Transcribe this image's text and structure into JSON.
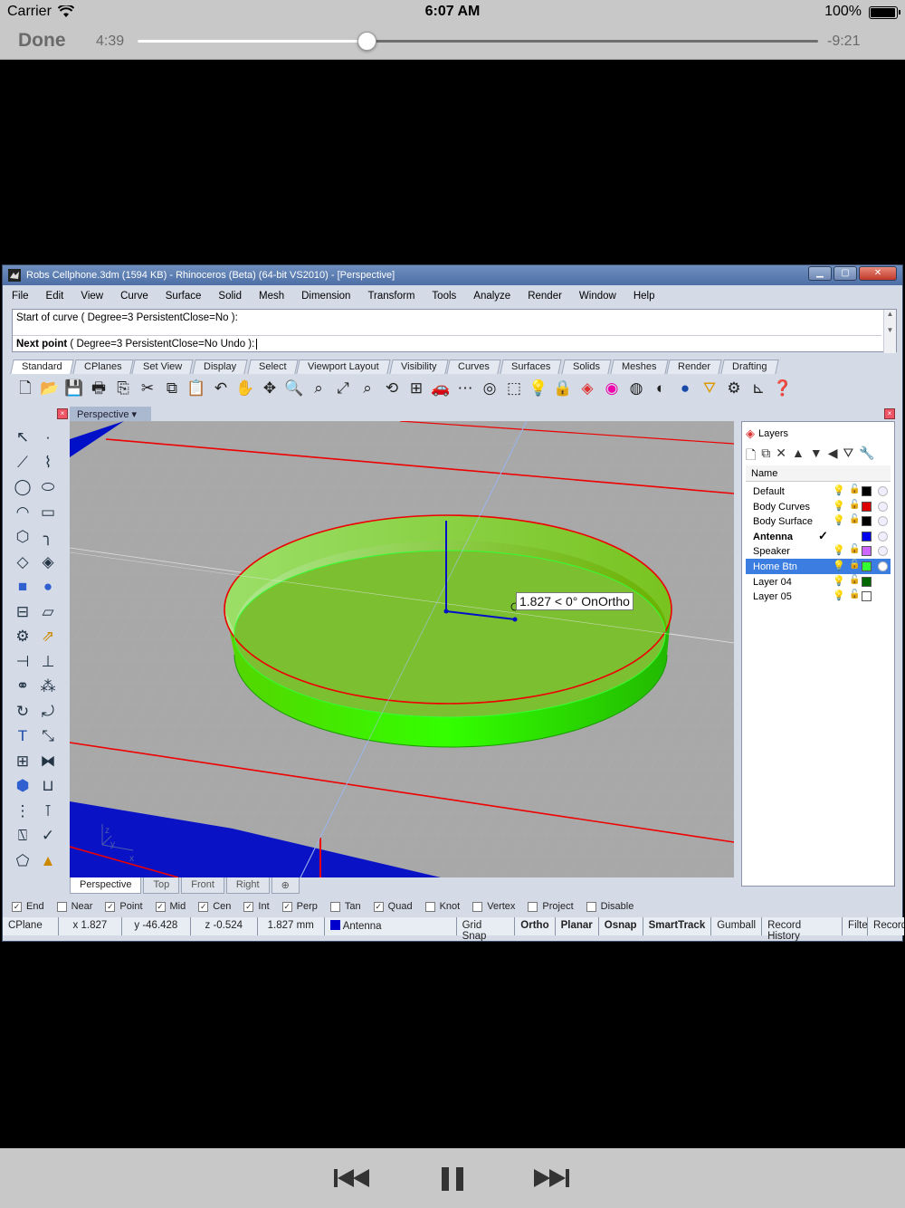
{
  "status": {
    "carrier": "Carrier",
    "time": "6:07 AM",
    "battery": "100%"
  },
  "player": {
    "done_label": "Done",
    "elapsed": "4:39",
    "remaining": "-9:21",
    "progress": 0.336
  },
  "window": {
    "title": "Robs Cellphone.3dm (1594 KB) - Rhinoceros (Beta) (64-bit VS2010) - [Perspective]",
    "menu": [
      "File",
      "Edit",
      "View",
      "Curve",
      "Surface",
      "Solid",
      "Mesh",
      "Dimension",
      "Transform",
      "Tools",
      "Analyze",
      "Render",
      "Window",
      "Help"
    ],
    "command_history": "Start of curve ( Degree=3  PersistentClose=No ):",
    "command_prompt_bold": "Next point",
    "command_prompt_rest": " ( Degree=3  PersistentClose=No  Undo ):",
    "toolbar_tabs": [
      "Standard",
      "CPlanes",
      "Set View",
      "Display",
      "Select",
      "Viewport Layout",
      "Visibility",
      "Curves",
      "Surfaces",
      "Solids",
      "Meshes",
      "Render",
      "Drafting"
    ],
    "viewport_title": "Perspective",
    "tooltip": "1.827 < 0° OnOrtho",
    "axis_labels": {
      "z": "z",
      "y": "y",
      "x": "x"
    },
    "viewport_tabs": [
      "Perspective",
      "Top",
      "Front",
      "Right"
    ],
    "layers_title": "Layers",
    "layers_col_name": "Name",
    "layers": [
      {
        "name": "Default",
        "color": "#000000"
      },
      {
        "name": "Body Curves",
        "color": "#dd0000"
      },
      {
        "name": "Body Surface",
        "color": "#000000"
      },
      {
        "name": "Antenna",
        "color": "#0000ee",
        "current": true
      },
      {
        "name": "Speaker",
        "color": "#cc66ff"
      },
      {
        "name": "Home Btn",
        "color": "#33ff33",
        "selected": true
      },
      {
        "name": "Layer 04",
        "color": "#006600"
      },
      {
        "name": "Layer 05",
        "color": "#ffffff"
      }
    ],
    "osnaps": [
      {
        "label": "End",
        "checked": true
      },
      {
        "label": "Near",
        "checked": false
      },
      {
        "label": "Point",
        "checked": true
      },
      {
        "label": "Mid",
        "checked": true
      },
      {
        "label": "Cen",
        "checked": true
      },
      {
        "label": "Int",
        "checked": true
      },
      {
        "label": "Perp",
        "checked": true
      },
      {
        "label": "Tan",
        "checked": false
      },
      {
        "label": "Quad",
        "checked": true
      },
      {
        "label": "Knot",
        "checked": false
      },
      {
        "label": "Vertex",
        "checked": false
      },
      {
        "label": "Project",
        "checked": false
      },
      {
        "label": "Disable",
        "checked": false
      }
    ],
    "statusbar": {
      "cplane": "CPlane",
      "x": "x 1.827",
      "y": "y -46.428",
      "z": "z -0.524",
      "distance": "1.827 mm",
      "layer": "Antenna",
      "grid_snap": "Grid Snap",
      "ortho": "Ortho",
      "planar": "Planar",
      "osnap": "Osnap",
      "smarttrack": "SmartTrack",
      "gumball": "Gumball",
      "record_history": "Record History",
      "filter": "Filter",
      "record": "Record"
    }
  }
}
